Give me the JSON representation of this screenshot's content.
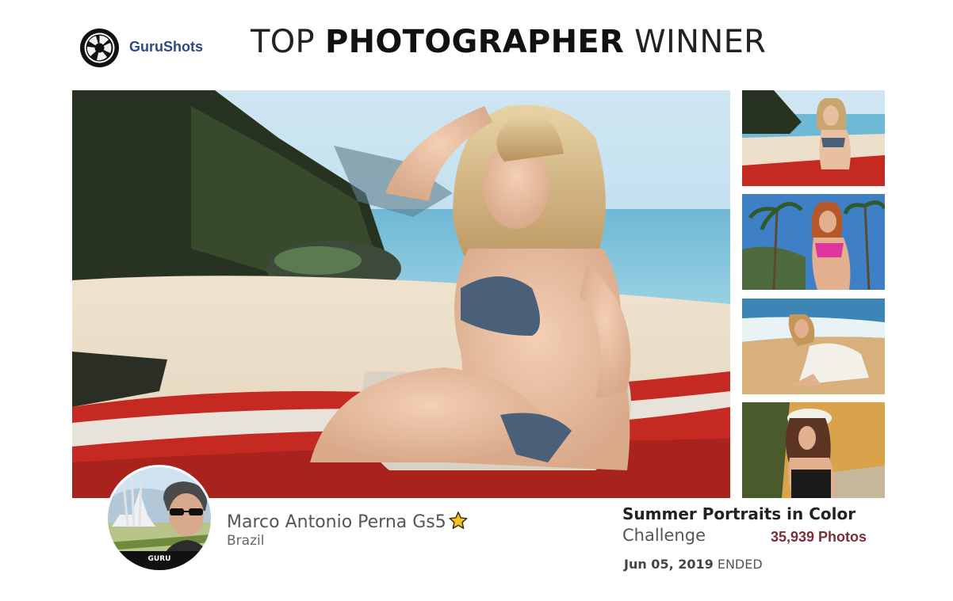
{
  "header": {
    "brand": "GuruShots",
    "title_light_1": "TOP ",
    "title_bold": "PHOTOGRAPHER",
    "title_light_2": " WINNER"
  },
  "winner": {
    "name": "Marco Antonio Perna Gs5",
    "country": "Brazil",
    "badge": "GURU"
  },
  "challenge": {
    "title": "Summer Portraits in Color",
    "label": "Challenge",
    "photo_count": "35,939 Photos",
    "date": "Jun 05, 2019",
    "status": "ENDED"
  },
  "colors": {
    "brand_text": "#2e4a80",
    "photo_count": "#7a3036",
    "sea": "#5fa9c9",
    "sand": "#e9dcc6",
    "boat_red": "#c42a22"
  },
  "icons": [
    "gurushots-logo-icon",
    "star-icon"
  ]
}
